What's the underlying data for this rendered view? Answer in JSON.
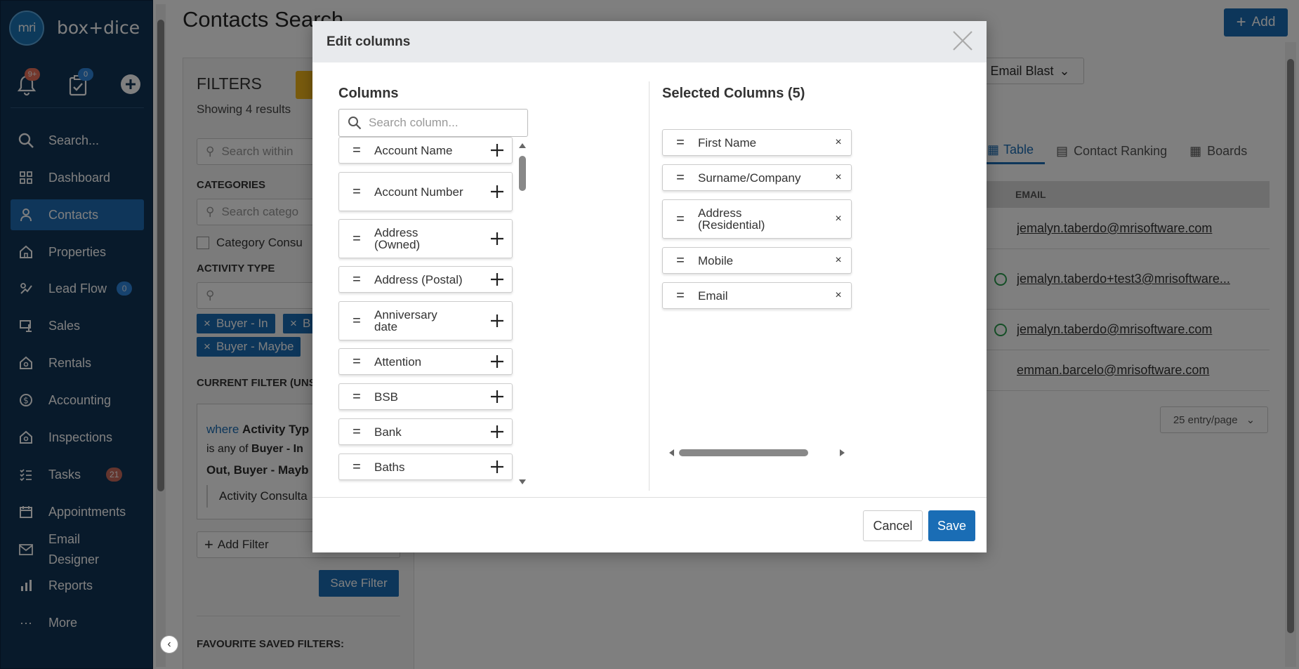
{
  "app": {
    "logo_mark": "mri",
    "logo_text": "box+dice"
  },
  "sidebar": {
    "notifications_badge": "9+",
    "tasks_badge": "0",
    "search_label": "Search...",
    "items": [
      {
        "label": "Dashboard",
        "icon": "dashboard-icon"
      },
      {
        "label": "Contacts",
        "icon": "contacts-icon",
        "active": true
      },
      {
        "label": "Properties",
        "icon": "properties-icon"
      },
      {
        "label": "Lead Flow",
        "icon": "lead-flow-icon",
        "badge": "0"
      },
      {
        "label": "Sales",
        "icon": "sales-icon"
      },
      {
        "label": "Rentals",
        "icon": "rentals-icon"
      },
      {
        "label": "Accounting",
        "icon": "accounting-icon"
      },
      {
        "label": "Inspections",
        "icon": "inspections-icon"
      },
      {
        "label": "Tasks",
        "icon": "tasks-icon",
        "badge": "21"
      },
      {
        "label": "Appointments",
        "icon": "appointments-icon"
      },
      {
        "label": "Email",
        "label2": "Designer",
        "icon": "email-designer-icon"
      },
      {
        "label": "Reports",
        "icon": "reports-icon"
      },
      {
        "label": "More",
        "icon": "more-icon"
      }
    ]
  },
  "page": {
    "title": "Contacts Search",
    "add_button": "Add",
    "email_blast": "Email Blast",
    "tabs": [
      "Table",
      "Contact Ranking",
      "Boards"
    ],
    "email_column_header": "EMAIL",
    "emails": [
      "jemalyn.taberdo@mrisoftware.com",
      "jemalyn.taberdo+test3@mrisoftware...",
      "jemalyn.taberdo@mrisoftware.com",
      "emman.barcelo@mrisoftware.com"
    ],
    "per_page": "25 entry/page"
  },
  "filters": {
    "title": "FILTERS",
    "showing": "Showing 4 results",
    "search_placeholder": "Search within",
    "categories_label": "CATEGORIES",
    "categories_placeholder": "Search catego",
    "category_checkbox": "Category Consu",
    "activity_type_label": "ACTIVITY TYPE",
    "tags": [
      "Buyer - In",
      "B",
      "Buyer - Maybe"
    ],
    "current_filter_label": "CURRENT FILTER (UNS",
    "filter_where": "where",
    "filter_field": "Activity Typ",
    "filter_op": "is any of",
    "filter_values": "Buyer - In",
    "filter_values2": "Out, Buyer - Mayb",
    "filter_sub": "Activity Consulta",
    "add_filter": "Add Filter",
    "save_filter": "Save Filter",
    "favourite_label": "FAVOURITE SAVED FILTERS:"
  },
  "modal": {
    "title": "Edit columns",
    "columns_title": "Columns",
    "search_placeholder": "Search column...",
    "available": [
      "Account Name",
      "Account Number",
      "Address (Owned)",
      "Address (Postal)",
      "Anniversary date",
      "Attention",
      "BSB",
      "Bank",
      "Baths"
    ],
    "selected_title": "Selected Columns (5)",
    "selected": [
      "First Name",
      "Surname/Company",
      "Address (Residential)",
      "Mobile",
      "Email"
    ],
    "cancel": "Cancel",
    "save": "Save"
  },
  "colors": {
    "sidebar_bg": "#113456",
    "accent": "#1a6db5",
    "badge_red": "#c0392b",
    "badge_blue": "#2e86de"
  }
}
